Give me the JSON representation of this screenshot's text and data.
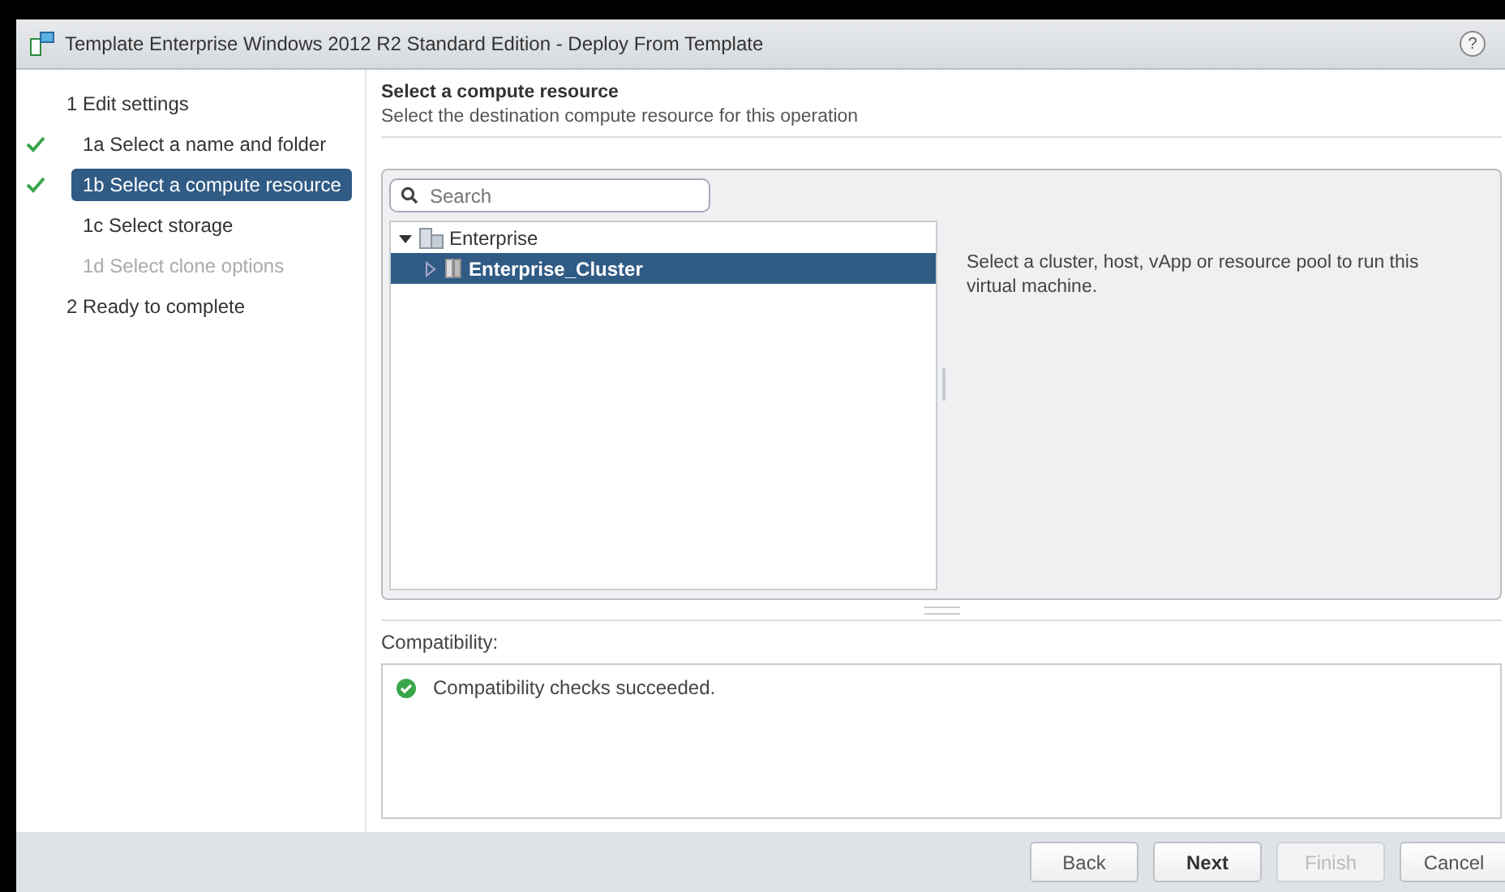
{
  "window": {
    "title": "Template Enterprise Windows 2012 R2 Standard Edition - Deploy From Template",
    "help": "?"
  },
  "steps": [
    {
      "label": "1  Edit settings",
      "selected": false,
      "done": false,
      "disabled": false,
      "children": [
        {
          "label": "1a  Select a name and folder",
          "selected": false,
          "done": true,
          "disabled": false
        },
        {
          "label": "1b  Select a compute resource",
          "selected": true,
          "done": true,
          "disabled": false
        },
        {
          "label": "1c  Select storage",
          "selected": false,
          "done": false,
          "disabled": false
        },
        {
          "label": "1d  Select clone options",
          "selected": false,
          "done": false,
          "disabled": true
        }
      ]
    },
    {
      "label": "2  Ready to complete",
      "selected": false,
      "done": false,
      "disabled": false
    }
  ],
  "page": {
    "title": "Select a compute resource",
    "subtitle": "Select the destination compute resource for this operation"
  },
  "search": {
    "placeholder": "Search"
  },
  "tree": [
    {
      "label": "Enterprise",
      "kind": "datacenter",
      "expanded": true,
      "selected": false,
      "children": [
        {
          "label": "Enterprise_Cluster",
          "kind": "cluster",
          "expanded": false,
          "selected": true
        }
      ]
    }
  ],
  "hint": "Select a cluster, host, vApp or resource pool to run this virtual machine.",
  "compatibility": {
    "label": "Compatibility:",
    "messages": [
      {
        "text": "Compatibility checks succeeded.",
        "succeeded": true
      }
    ]
  },
  "buttons": [
    {
      "label": "Back",
      "primary": false,
      "disabled": false
    },
    {
      "label": "Next",
      "primary": true,
      "disabled": false
    },
    {
      "label": "Finish",
      "primary": false,
      "disabled": true
    },
    {
      "label": "Cancel",
      "primary": false,
      "disabled": false
    }
  ]
}
